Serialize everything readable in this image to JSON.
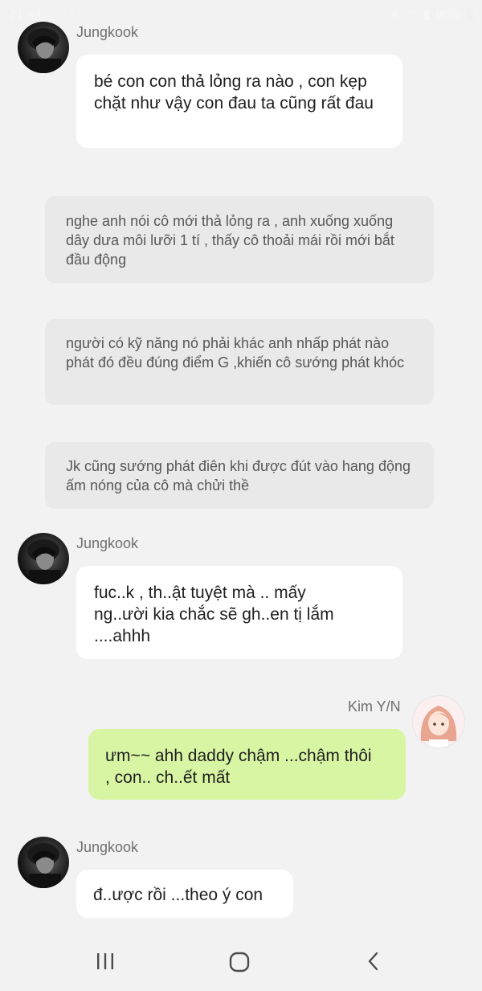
{
  "status_bar": {
    "time": "21:44",
    "battery": "80%"
  },
  "messages": [
    {
      "type": "incoming",
      "sender": "Jungkook",
      "text": "bé con con thả lỏng ra nào , con kẹp chặt như vậy con đau ta cũng rất đau"
    },
    {
      "type": "narration",
      "text": "nghe anh nói cô mới thả lỏng ra , anh xuống xuống dây dưa môi lưỡi 1 tí , thấy cô thoải mái rồi mới bắt đầu động"
    },
    {
      "type": "narration",
      "text": "người có kỹ năng nó phải khác anh nhấp phát nào phát đó đều đúng điểm G ,khiến cô sướng phát khóc"
    },
    {
      "type": "narration",
      "text": "Jk cũng sướng phát điên khi được đút vào hang động ấm nóng của cô mà chửi thề"
    },
    {
      "type": "incoming",
      "sender": "Jungkook",
      "text": "fuc..k , th..ật tuyệt mà .. mấy ng..ười kia chắc sẽ gh..en tị lắm ....ahhh"
    },
    {
      "type": "outgoing",
      "sender": "Kim Y/N",
      "text": "ưm~~ ahh daddy chậm ...chậm thôi , con.. ch..ết mất"
    },
    {
      "type": "incoming",
      "sender": "Jungkook",
      "text": "đ..ược rồi ...theo ý con"
    }
  ],
  "nav_bar": {
    "recent_icon": "recent-apps-icon",
    "home_icon": "home-icon",
    "back_icon": "back-icon"
  }
}
